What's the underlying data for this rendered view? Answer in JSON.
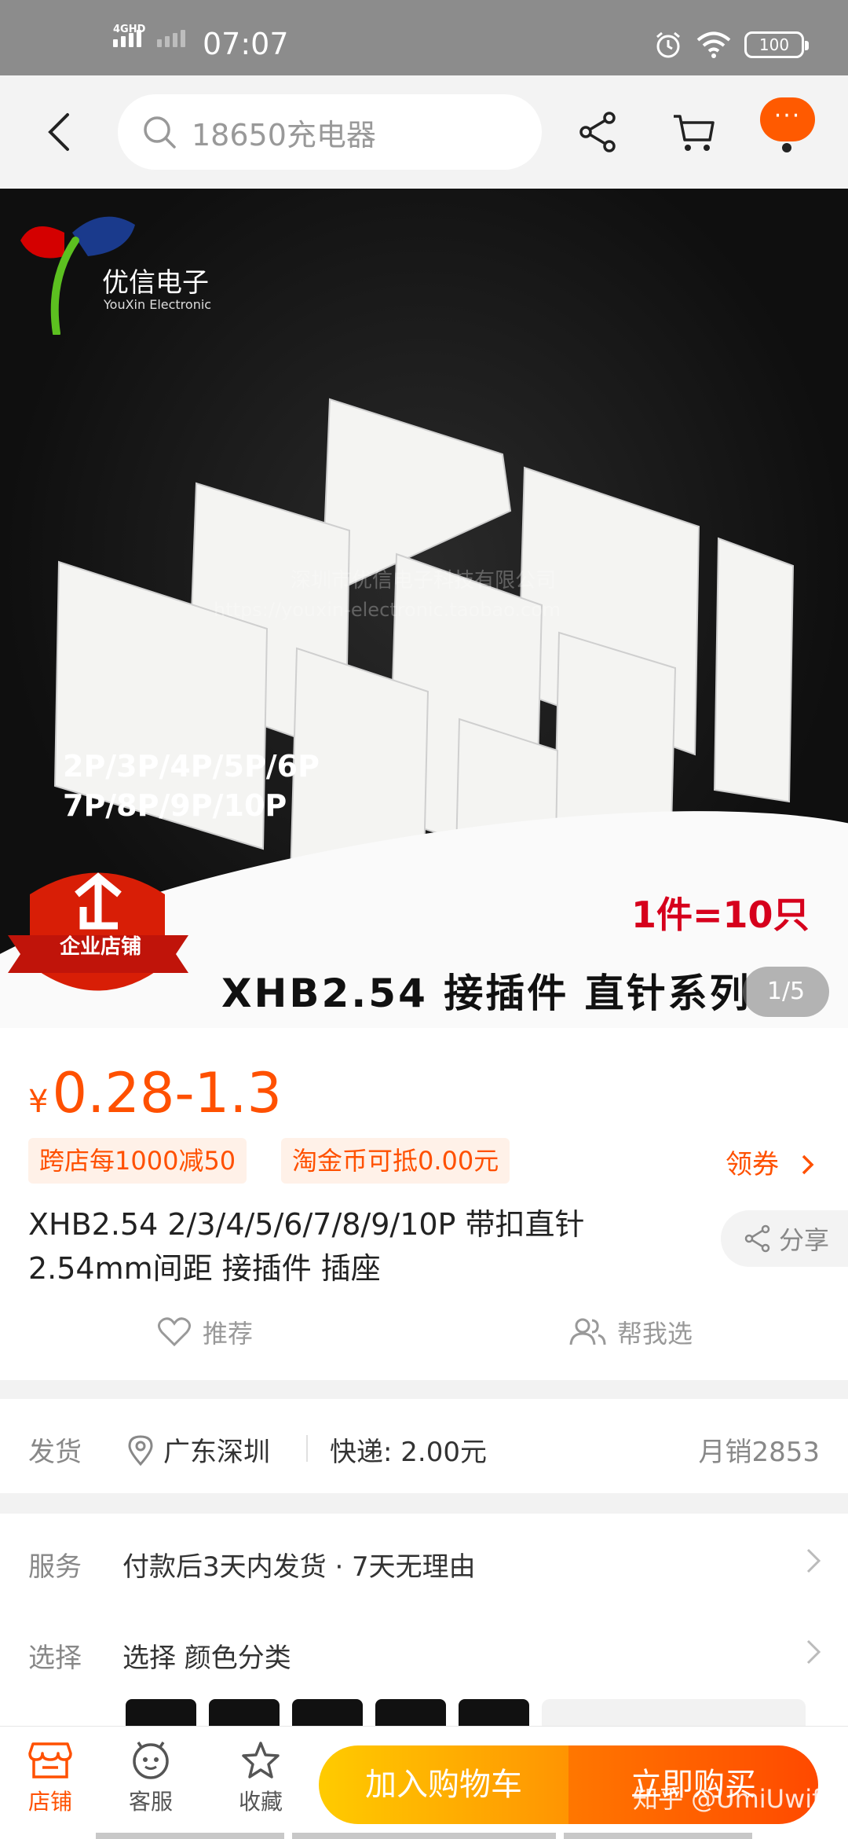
{
  "status_bar": {
    "network": "4GHD",
    "time": "07:07",
    "battery": "100",
    "icons": [
      "signal-icon",
      "alarm-icon",
      "wifi-icon",
      "battery-icon"
    ]
  },
  "nav": {
    "search_placeholder": "18650充电器",
    "more_label": "···",
    "icons": [
      "back-icon",
      "search-icon",
      "share-icon",
      "cart-icon"
    ]
  },
  "hero": {
    "brand_name": "优信电子",
    "brand_sub": "YouXin Electronic",
    "pins_line1": "2P/3P/4P/5P/6P",
    "pins_line2": "7P/8P/9P/10P",
    "quantity": "1件=10只",
    "series": "XHB2.54 接插件 直针系列",
    "watermark_line1": "深圳市优信电子科技有限公司",
    "watermark_line2": "https://youxin-electronic.taobao.com",
    "badge_label": "企业店铺",
    "page_indicator": "1/5"
  },
  "product": {
    "currency": "¥",
    "price": "0.28-1.3",
    "promo1": "跨店每1000减50",
    "promo2": "淘金币可抵0.00元",
    "coupon": "领券",
    "title": "XHB2.54 2/3/4/5/6/7/8/9/10P 带扣直针2.54mm间距 接插件 插座",
    "share": "分享",
    "recommend": "推荐",
    "help_choose": "帮我选"
  },
  "shipping": {
    "label": "发货",
    "location": "广东深圳",
    "fee": "快递: 2.00元",
    "monthly_sales": "月销2853"
  },
  "service": {
    "label": "服务",
    "text": "付款后3天内发货 · 7天无理由"
  },
  "select": {
    "label": "选择",
    "text": "选择 颜色分类"
  },
  "bottom_bar": {
    "shop": "店铺",
    "service": "客服",
    "favorite": "收藏",
    "add_to_cart": "加入购物车",
    "buy_now": "立即购买"
  },
  "watermark": "知乎 @UmiUwifi",
  "colors": {
    "accent": "#ff5000",
    "cart_gradient": [
      "#ffcb00",
      "#ff9402"
    ],
    "buy_gradient": [
      "#ff7700",
      "#ff4900"
    ],
    "status_bar": "#8c8c8c"
  }
}
